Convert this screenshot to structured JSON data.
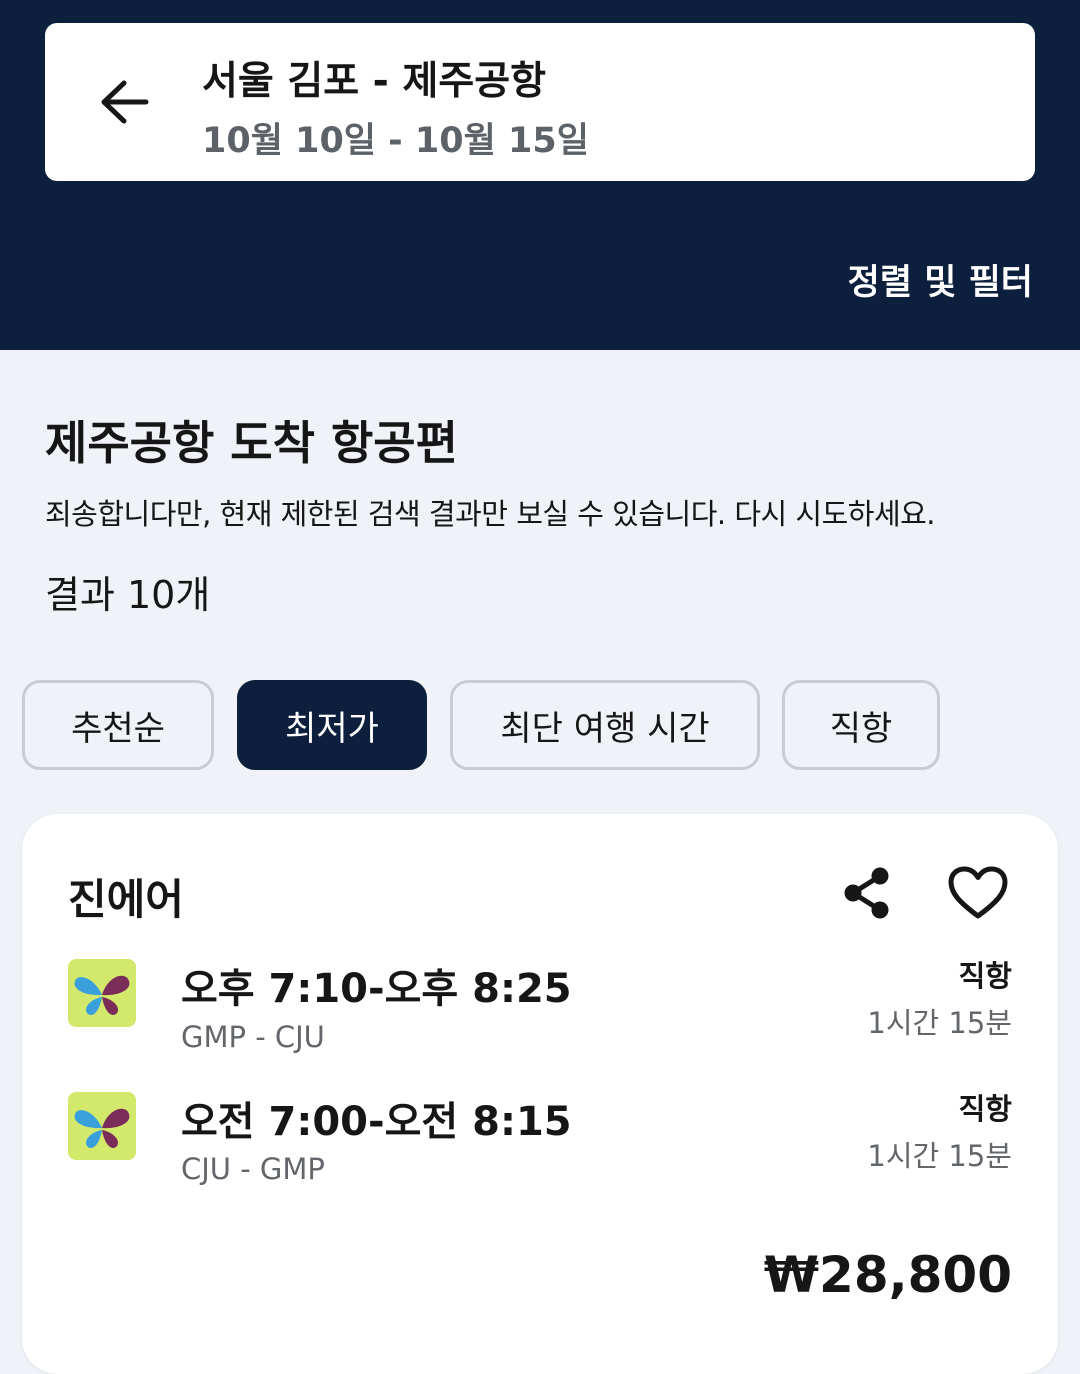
{
  "header": {
    "route": "서울 김포 - 제주공항",
    "dates": "10월 10일 - 10월 15일",
    "sort_filter": "정렬 및 필터"
  },
  "results": {
    "heading": "제주공항 도착 항공편",
    "notice": "죄송합니다만, 현재 제한된 검색 결과만 보실 수 있습니다. 다시 시도하세요.",
    "count": "결과 10개"
  },
  "sort_chips": [
    {
      "label": "추천순",
      "active": false
    },
    {
      "label": "최저가",
      "active": true
    },
    {
      "label": "최단 여행 시간",
      "active": false
    },
    {
      "label": "직항",
      "active": false
    }
  ],
  "card": {
    "airline": "진에어",
    "legs": [
      {
        "time": "오후 7:10-오후 8:25",
        "airports": "GMP - CJU",
        "stops": "직항",
        "duration": "1시간 15분"
      },
      {
        "time": "오전 7:00-오전 8:15",
        "airports": "CJU - GMP",
        "stops": "직항",
        "duration": "1시간 15분"
      }
    ],
    "price": "₩28,800"
  },
  "icons": {
    "back": "arrow-left-icon",
    "share": "share-icon",
    "favorite": "heart-icon",
    "airline_logo": "jinair-butterfly-logo"
  },
  "colors": {
    "header_bg": "#0c1f3c",
    "page_bg": "#eff2f7",
    "active_chip": "#0c1f3c",
    "logo_bg": "#d3e96b",
    "logo_blue": "#3aa0dc",
    "logo_purple": "#7b2d59"
  }
}
